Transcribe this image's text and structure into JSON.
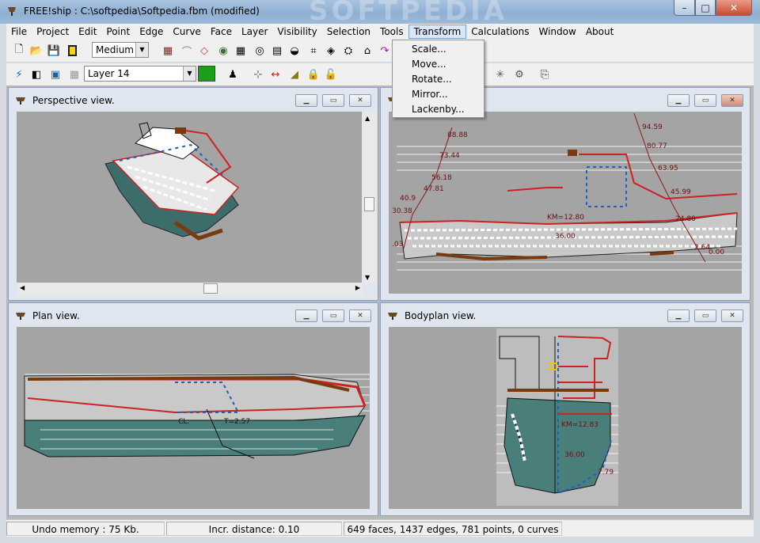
{
  "window": {
    "title": "FREE!ship    : C:\\softpedia\\Softpedia.fbm (modified)",
    "watermark": "SOFTPEDIA",
    "min_glyph": "–",
    "max_glyph": "□",
    "close_glyph": "✕"
  },
  "menu": [
    "File",
    "Project",
    "Edit",
    "Point",
    "Edge",
    "Curve",
    "Face",
    "Layer",
    "Visibility",
    "Selection",
    "Tools",
    "Transform",
    "Calculations",
    "Window",
    "About"
  ],
  "transform_menu": [
    "Scale...",
    "Move...",
    "Rotate...",
    "Mirror...",
    "Lackenby..."
  ],
  "toolbar": {
    "precision_value": "Medium",
    "layer_value": "Layer 14",
    "layer_color": "#1aa017"
  },
  "views": {
    "perspective": "Perspective view.",
    "profile": "",
    "plan": "Plan view.",
    "bodyplan": "Bodyplan view."
  },
  "profile_labels": [
    "88.88",
    "73.44",
    "56.18",
    "47.81",
    "40.9",
    "30.38",
    "94.59",
    "80.77",
    "63.95",
    "45.99",
    "24.80",
    "2.64",
    "0.00",
    ".03",
    "KM=12.80",
    "36.00"
  ],
  "plan_labels": [
    "CL:",
    "T=2.57"
  ],
  "bodyplan_labels": [
    "KM=12.83",
    "36.00",
    "7.79"
  ],
  "status": {
    "undo": "Undo memory : 75 Kb.",
    "incr": "Incr. distance: 0.10",
    "counts": "649 faces, 1437 edges, 781 points, 0 curves"
  }
}
